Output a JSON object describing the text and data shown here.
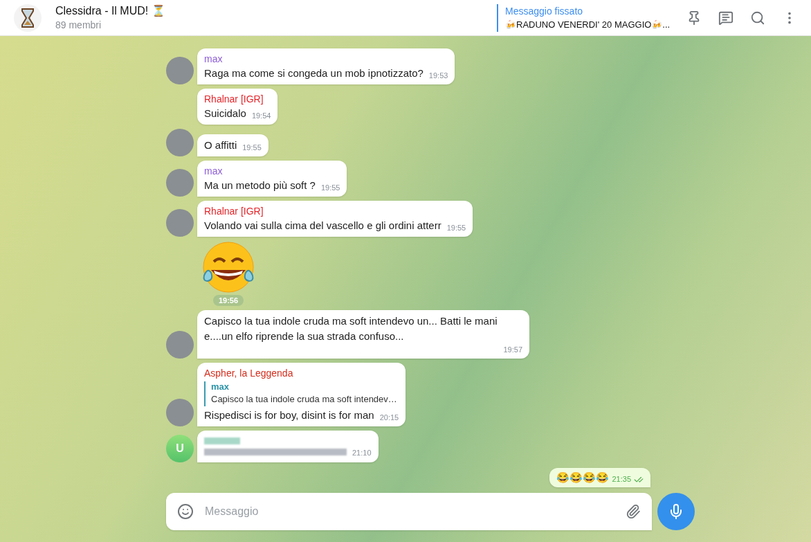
{
  "header": {
    "title": "Clessidra - Il MUD! ⏳",
    "subtitle": "89 membri",
    "pinned": {
      "label": "Messaggio fissato",
      "text": "🍻RADUNO VENERDI' 20 MAGGIO🍻..."
    }
  },
  "messages": [
    {
      "kind": "text",
      "sender": "max",
      "color": "#8e5fd6",
      "text": "Raga ma come si congeda un mob ipnotizzato?",
      "time": "19:53",
      "avatar": {
        "kind": "photo"
      }
    },
    {
      "kind": "text",
      "sender": "Rhalnar [IGR]",
      "color": "#e5252a",
      "text": "Suicidalo",
      "time": "19:54"
    },
    {
      "kind": "text",
      "text": "O affitti",
      "time": "19:55",
      "avatar": {
        "kind": "photo"
      }
    },
    {
      "kind": "text",
      "sender": "max",
      "color": "#8e5fd6",
      "text": "Ma un metodo più soft ?",
      "time": "19:55",
      "avatar": {
        "kind": "photo"
      }
    },
    {
      "kind": "text",
      "sender": "Rhalnar [IGR]",
      "color": "#e5252a",
      "text": "Volando vai sulla cima del vascello e gli ordini atterr",
      "time": "19:55",
      "avatar": {
        "kind": "photo"
      }
    },
    {
      "kind": "sticker",
      "time": "19:56"
    },
    {
      "kind": "text",
      "text": "Capisco la tua indole cruda ma soft intendevo un... Batti le mani e....un elfo riprende la sua strada confuso...",
      "time": "19:57",
      "avatar": {
        "kind": "photo"
      }
    },
    {
      "kind": "reply",
      "sender": "Aspher, la Leggenda",
      "color": "#d52c1c",
      "reply_sender": "max",
      "reply_text": "Capisco la tua indole cruda ma soft intendev…",
      "text": "Rispedisci is for boy, disint is for man",
      "time": "20:15",
      "avatar": {
        "kind": "photo"
      }
    },
    {
      "kind": "blurred",
      "time": "21:10",
      "avatar": {
        "kind": "letter",
        "letter": "U"
      }
    }
  ],
  "outgoing": {
    "text": "😂😂😂😂",
    "time": "21:35",
    "read": true
  },
  "composer": {
    "placeholder": "Messaggio"
  }
}
